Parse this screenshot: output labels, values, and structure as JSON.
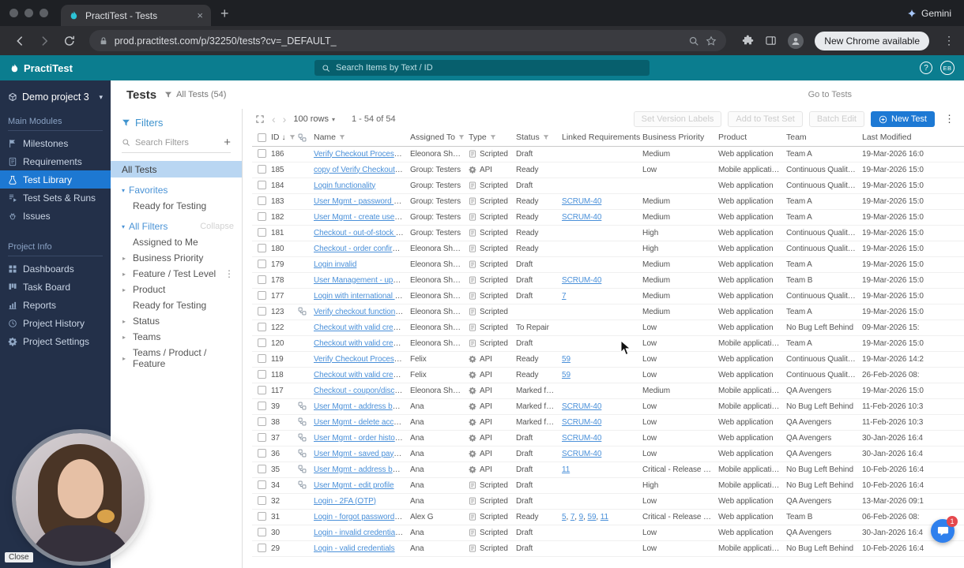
{
  "browser": {
    "tab_title": "PractiTest - Tests",
    "gemini_label": "Gemini",
    "url": "prod.practitest.com/p/32250/tests?cv=_DEFAULT_",
    "new_chrome_label": "New Chrome available"
  },
  "app_header": {
    "logo_text": "PractiTest",
    "search_placeholder": "Search Items by Text / ID",
    "help_label": "?",
    "avatar_initials": "EB"
  },
  "sidebar": {
    "project_name": "Demo project 3",
    "sections": [
      {
        "label": "Main Modules",
        "items": [
          {
            "label": "Milestones",
            "icon": "milestones-icon",
            "active": false
          },
          {
            "label": "Requirements",
            "icon": "requirements-icon",
            "active": false
          },
          {
            "label": "Test Library",
            "icon": "test-library-icon",
            "active": true
          },
          {
            "label": "Test Sets & Runs",
            "icon": "test-sets-icon",
            "active": false
          },
          {
            "label": "Issues",
            "icon": "issues-icon",
            "active": false
          }
        ]
      },
      {
        "label": "Project Info",
        "items": [
          {
            "label": "Dashboards",
            "icon": "dashboards-icon",
            "active": false
          },
          {
            "label": "Task Board",
            "icon": "task-board-icon",
            "active": false
          },
          {
            "label": "Reports",
            "icon": "reports-icon",
            "active": false
          },
          {
            "label": "Project History",
            "icon": "history-icon",
            "active": false
          },
          {
            "label": "Project Settings",
            "icon": "settings-icon",
            "active": false
          }
        ]
      }
    ]
  },
  "filters_panel": {
    "title": "Filters",
    "search_placeholder": "Search Filters",
    "all_tests_label": "All Tests",
    "groups": [
      {
        "label": "Favorites",
        "action": "",
        "items": [
          {
            "label": "Ready for Testing",
            "expandable": false,
            "has_menu": false
          }
        ]
      },
      {
        "label": "All Filters",
        "action": "Collapse",
        "items": [
          {
            "label": "Assigned to Me",
            "expandable": false,
            "has_menu": false
          },
          {
            "label": "Business Priority",
            "expandable": true,
            "has_menu": false
          },
          {
            "label": "Feature / Test Level",
            "expandable": true,
            "has_menu": true
          },
          {
            "label": "Product",
            "expandable": true,
            "has_menu": false
          },
          {
            "label": "Ready for Testing",
            "expandable": false,
            "has_menu": false
          },
          {
            "label": "Status",
            "expandable": true,
            "has_menu": false
          },
          {
            "label": "Teams",
            "expandable": true,
            "has_menu": false
          },
          {
            "label": "Teams / Product / Feature",
            "expandable": true,
            "has_menu": false
          }
        ]
      }
    ]
  },
  "page": {
    "title": "Tests",
    "view_label": "All Tests (54)",
    "go_to_tests": "Go to Tests"
  },
  "toolbar": {
    "rows_selector": "100 rows",
    "range_label": "1 - 54 of 54",
    "set_version_labels": "Set Version Labels",
    "add_to_test_set": "Add to Test Set",
    "batch_edit": "Batch Edit",
    "new_test": "New Test"
  },
  "table": {
    "columns": [
      {
        "label": "ID",
        "sorted": true,
        "funnel": true
      },
      {
        "label": "Name",
        "sorted": false,
        "funnel": true
      },
      {
        "label": "Assigned To",
        "sorted": false,
        "funnel": true
      },
      {
        "label": "Type",
        "sorted": false,
        "funnel": true
      },
      {
        "label": "Status",
        "sorted": false,
        "funnel": true
      },
      {
        "label": "Linked Requirements",
        "sorted": false,
        "funnel": false
      },
      {
        "label": "Business Priority",
        "sorted": false,
        "funnel": false
      },
      {
        "label": "Product",
        "sorted": false,
        "funnel": false
      },
      {
        "label": "Team",
        "sorted": false,
        "funnel": false
      },
      {
        "label": "Last Modified",
        "sorted": false,
        "funnel": false
      }
    ],
    "rows": [
      {
        "id": "186",
        "called": false,
        "name": "Verify Checkout Process wi...",
        "assigned": "Eleonora Shein",
        "type": "Scripted",
        "status": "Draft",
        "linked": [],
        "priority": "Medium",
        "product": "Web application",
        "team": "Team A",
        "modified": "19-Mar-2026 16:0"
      },
      {
        "id": "185",
        "called": false,
        "name": "copy of Verify Checkout P...",
        "assigned": "Group: Testers",
        "type": "API",
        "status": "Ready",
        "linked": [],
        "priority": "Low",
        "product": "Mobile application",
        "team": "Continuous Quality Crew",
        "modified": "19-Mar-2026 15:0"
      },
      {
        "id": "184",
        "called": false,
        "name": "Login functionality",
        "assigned": "Group: Testers",
        "type": "Scripted",
        "status": "Draft",
        "linked": [],
        "priority": "",
        "product": "Web application",
        "team": "Continuous Quality Crew",
        "modified": "19-Mar-2026 15:0"
      },
      {
        "id": "183",
        "called": false,
        "name": "User Mgmt - password res...",
        "assigned": "Group: Testers",
        "type": "Scripted",
        "status": "Ready",
        "linked": [
          "SCRUM-40"
        ],
        "priority": "Medium",
        "product": "Web application",
        "team": "Team A",
        "modified": "19-Mar-2026 15:0"
      },
      {
        "id": "182",
        "called": false,
        "name": "User Mgmt - create user w...",
        "assigned": "Group: Testers",
        "type": "Scripted",
        "status": "Ready",
        "linked": [
          "SCRUM-40"
        ],
        "priority": "Medium",
        "product": "Web application",
        "team": "Team A",
        "modified": "19-Mar-2026 15:0"
      },
      {
        "id": "181",
        "called": false,
        "name": "Checkout - out-of-stock ite...",
        "assigned": "Group: Testers",
        "type": "Scripted",
        "status": "Ready",
        "linked": [],
        "priority": "High",
        "product": "Web application",
        "team": "Continuous Quality Crew",
        "modified": "19-Mar-2026 15:0"
      },
      {
        "id": "180",
        "called": false,
        "name": "Checkout - order confirma...",
        "assigned": "Eleonora Shein",
        "type": "Scripted",
        "status": "Ready",
        "linked": [],
        "priority": "High",
        "product": "Web application",
        "team": "Continuous Quality Crew",
        "modified": "19-Mar-2026 15:0"
      },
      {
        "id": "179",
        "called": false,
        "name": "Login invalid",
        "assigned": "Eleonora Shein",
        "type": "Scripted",
        "status": "Draft",
        "linked": [],
        "priority": "Medium",
        "product": "Web application",
        "team": "Team A",
        "modified": "19-Mar-2026 15:0"
      },
      {
        "id": "178",
        "called": false,
        "name": "User Management - update",
        "assigned": "Eleonora Shein",
        "type": "Scripted",
        "status": "Draft",
        "linked": [
          "SCRUM-40"
        ],
        "priority": "Medium",
        "product": "Web application",
        "team": "Team B",
        "modified": "19-Mar-2026 15:0"
      },
      {
        "id": "177",
        "called": false,
        "name": "Login with international Ch...",
        "assigned": "Eleonora Shein",
        "type": "Scripted",
        "status": "Draft",
        "linked": [
          "7"
        ],
        "priority": "Medium",
        "product": "Web application",
        "team": "Continuous Quality Crew",
        "modified": "19-Mar-2026 15:0"
      },
      {
        "id": "123",
        "called": true,
        "name": "Verify checkout functionali...",
        "assigned": "Eleonora Shein",
        "type": "Scripted",
        "status": "",
        "linked": [],
        "priority": "Medium",
        "product": "Web application",
        "team": "Team A",
        "modified": "19-Mar-2026 15:0"
      },
      {
        "id": "122",
        "called": false,
        "name": "Checkout with valid credit ...",
        "assigned": "Eleonora Shein",
        "type": "Scripted",
        "status": "To Repair",
        "linked": [],
        "priority": "Low",
        "product": "Web application",
        "team": "No Bug Left Behind",
        "modified": "09-Mar-2026 15:"
      },
      {
        "id": "120",
        "called": false,
        "name": "Checkout with valid credit ...",
        "assigned": "Eleonora Shein",
        "type": "Scripted",
        "status": "Draft",
        "linked": [],
        "priority": "Low",
        "product": "Mobile application",
        "team": "Team A",
        "modified": "19-Mar-2026 15:0"
      },
      {
        "id": "119",
        "called": false,
        "name": "Verify Checkout Process wi...",
        "assigned": "Felix",
        "type": "API",
        "status": "Ready",
        "linked": [
          "59"
        ],
        "priority": "Low",
        "product": "Web application",
        "team": "Continuous Quality Crew",
        "modified": "19-Mar-2026 14:2"
      },
      {
        "id": "118",
        "called": false,
        "name": "Checkout with valid creden...",
        "assigned": "Felix",
        "type": "API",
        "status": "Ready",
        "linked": [
          "59"
        ],
        "priority": "Low",
        "product": "Web application",
        "team": "Continuous Quality Crew",
        "modified": "26-Feb-2026 08:"
      },
      {
        "id": "117",
        "called": false,
        "name": "Checkout - coupon/discou...",
        "assigned": "Eleonora Shein",
        "type": "API",
        "status": "Marked for ...",
        "linked": [],
        "priority": "Medium",
        "product": "Mobile application",
        "team": "QA Avengers",
        "modified": "19-Mar-2026 15:0"
      },
      {
        "id": "39",
        "called": true,
        "name": "User Mgmt - address book...",
        "assigned": "Ana",
        "type": "API",
        "status": "Marked for ...",
        "linked": [
          "SCRUM-40"
        ],
        "priority": "Low",
        "product": "Mobile application",
        "team": "No Bug Left Behind",
        "modified": "11-Feb-2026 10:3"
      },
      {
        "id": "38",
        "called": true,
        "name": "User Mgmt - delete accou...",
        "assigned": "Ana",
        "type": "API",
        "status": "Marked for ...",
        "linked": [
          "SCRUM-40"
        ],
        "priority": "Low",
        "product": "Web application",
        "team": "QA Avengers",
        "modified": "11-Feb-2026 10:3"
      },
      {
        "id": "37",
        "called": true,
        "name": "User Mgmt - order history ...",
        "assigned": "Ana",
        "type": "API",
        "status": "Draft",
        "linked": [
          "SCRUM-40"
        ],
        "priority": "Low",
        "product": "Web application",
        "team": "QA Avengers",
        "modified": "30-Jan-2026 16:4"
      },
      {
        "id": "36",
        "called": true,
        "name": "User Mgmt - saved payme...",
        "assigned": "Ana",
        "type": "API",
        "status": "Draft",
        "linked": [
          "SCRUM-40"
        ],
        "priority": "Low",
        "product": "Web application",
        "team": "QA Avengers",
        "modified": "30-Jan-2026 16:4"
      },
      {
        "id": "35",
        "called": true,
        "name": "User Mgmt - address book...",
        "assigned": "Ana",
        "type": "API",
        "status": "Draft",
        "linked": [
          "11"
        ],
        "priority": "Critical - Release blocker",
        "product": "Mobile application",
        "team": "No Bug Left Behind",
        "modified": "10-Feb-2026 16:4"
      },
      {
        "id": "34",
        "called": true,
        "name": "User Mgmt - edit profile",
        "assigned": "Ana",
        "type": "Scripted",
        "status": "Draft",
        "linked": [],
        "priority": "High",
        "product": "Mobile application",
        "team": "No Bug Left Behind",
        "modified": "10-Feb-2026 16:4"
      },
      {
        "id": "32",
        "called": false,
        "name": "Login - 2FA (OTP)",
        "assigned": "Ana",
        "type": "Scripted",
        "status": "Draft",
        "linked": [],
        "priority": "Low",
        "product": "Web application",
        "team": "QA Avengers",
        "modified": "13-Mar-2026 09:1"
      },
      {
        "id": "31",
        "called": false,
        "name": "Login - forgot password fl...",
        "assigned": "Alex G",
        "type": "Scripted",
        "status": "Ready",
        "linked": [
          "5",
          "7",
          "9",
          "59",
          "11"
        ],
        "priority": "Critical - Release blocker",
        "product": "Web application",
        "team": "Team B",
        "modified": "06-Feb-2026 08:"
      },
      {
        "id": "30",
        "called": false,
        "name": "Login - invalid credentials ...",
        "assigned": "Ana",
        "type": "Scripted",
        "status": "Draft",
        "linked": [],
        "priority": "Low",
        "product": "Web application",
        "team": "QA Avengers",
        "modified": "30-Jan-2026 16:4"
      },
      {
        "id": "29",
        "called": false,
        "name": "Login - valid credentials",
        "assigned": "Ana",
        "type": "Scripted",
        "status": "Draft",
        "linked": [],
        "priority": "Low",
        "product": "Mobile application",
        "team": "No Bug Left Behind",
        "modified": "10-Feb-2026 16:4"
      }
    ]
  },
  "overlays": {
    "close_label": "Close",
    "chat_badge": "1"
  },
  "colors": {
    "header_teal": "#0b7d8f",
    "sidebar_navy": "#233049",
    "active_blue": "#1d78d2",
    "link_blue": "#4a90d9",
    "selected_filter_bg": "#b9d6f2",
    "primary_button": "#1d79d4"
  }
}
